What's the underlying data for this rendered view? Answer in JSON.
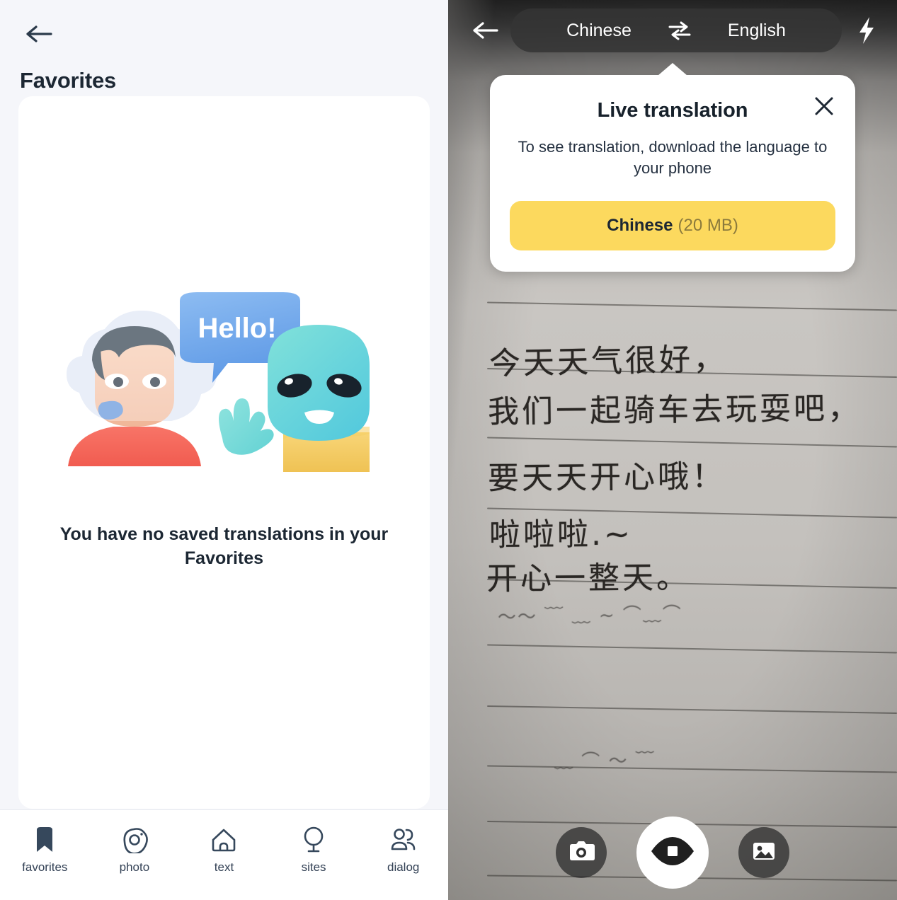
{
  "favorites": {
    "back_icon": "arrow-left-icon",
    "title": "Favorites",
    "illustration": {
      "bubble_text": "Hello!",
      "astronaut_icon": "astronaut-avatar",
      "alien_icon": "alien-avatar"
    },
    "empty_message": "You have no saved translations in your Favorites",
    "nav": [
      {
        "label": "favorites",
        "icon": "bookmark-icon",
        "active": true
      },
      {
        "label": "photo",
        "icon": "camera-icon",
        "active": false
      },
      {
        "label": "text",
        "icon": "house-icon",
        "active": false
      },
      {
        "label": "sites",
        "icon": "globe-icon",
        "active": false
      },
      {
        "label": "dialog",
        "icon": "people-icon",
        "active": false
      }
    ]
  },
  "camera": {
    "back_icon": "arrow-left-icon",
    "source_language": "Chinese",
    "swap_icon": "swap-horizontal-icon",
    "target_language": "English",
    "flash_icon": "flash-icon",
    "popup": {
      "title": "Live translation",
      "close_icon": "close-icon",
      "description": "To see translation, download the language to your phone",
      "download_language": "Chinese",
      "download_size": "(20 MB)"
    },
    "scene_text_lines": [
      "今天天气很好，",
      "我们一起骑车去玩耍吧，",
      "要天天开心哦！",
      "啦啦啦.~",
      "开心一整天。"
    ],
    "controls": [
      {
        "name": "photo-capture",
        "icon": "camera-icon",
        "active": false
      },
      {
        "name": "live-translate",
        "icon": "eye-icon",
        "active": true
      },
      {
        "name": "gallery",
        "icon": "image-icon",
        "active": false
      }
    ]
  },
  "colors": {
    "accent_yellow": "#fcd95e",
    "text_dark": "#1c2733",
    "panel_bg": "#f5f6fa",
    "bubble_blue": "#6fa8ec",
    "alien_teal": "#6ad5d6",
    "astronaut_shirt": "#f4685c",
    "alien_shirt": "#f5cd63"
  }
}
